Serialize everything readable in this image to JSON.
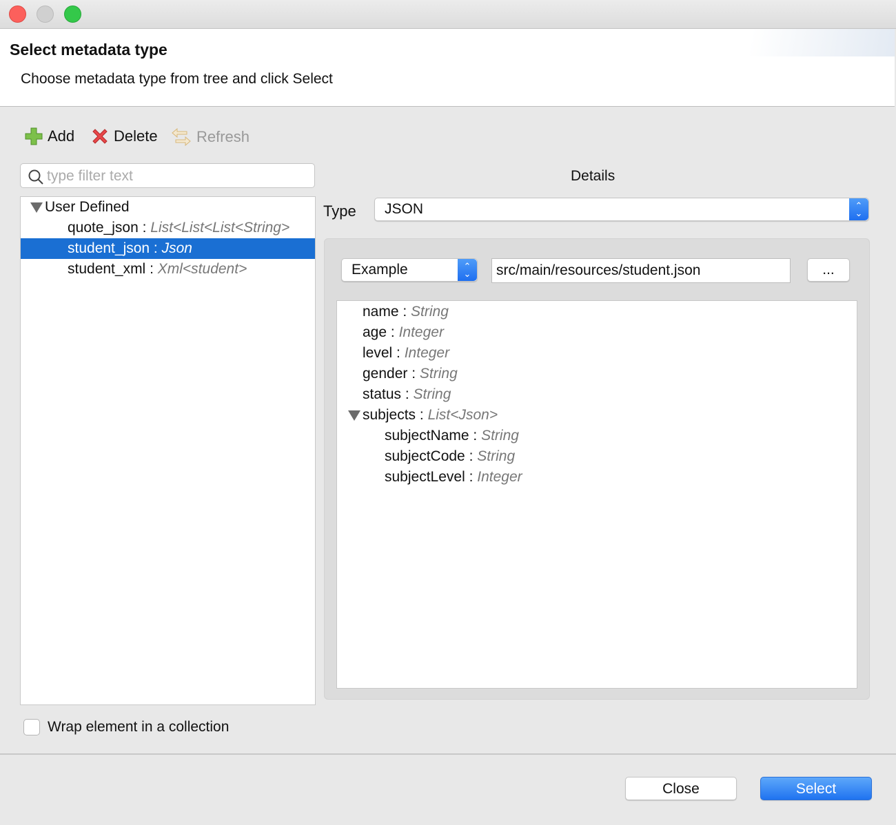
{
  "header": {
    "title": "Select metadata type",
    "subtitle": "Choose metadata type from tree and click Select"
  },
  "toolbar": {
    "add": "Add",
    "delete": "Delete",
    "refresh": "Refresh"
  },
  "filter": {
    "placeholder": "type filter text"
  },
  "tree": {
    "group": "User Defined",
    "items": [
      {
        "name": "quote_json",
        "sep": " : ",
        "type": "List<List<List<String>"
      },
      {
        "name": "student_json",
        "sep": " : ",
        "type": "Json",
        "selected": true
      },
      {
        "name": "student_xml",
        "sep": " : ",
        "type": "Xml<student>"
      }
    ]
  },
  "details": {
    "heading": "Details",
    "type_label": "Type",
    "type_value": "JSON",
    "source_value": "Example",
    "path_value": "src/main/resources/student.json",
    "browse_label": "...",
    "fields": [
      {
        "name": "name",
        "sep": " : ",
        "type": "String"
      },
      {
        "name": "age",
        "sep": " : ",
        "type": "Integer"
      },
      {
        "name": "level",
        "sep": " : ",
        "type": "Integer"
      },
      {
        "name": "gender",
        "sep": " : ",
        "type": "String"
      },
      {
        "name": "status",
        "sep": " : ",
        "type": "String"
      },
      {
        "name": "subjects",
        "sep": " : ",
        "type": "List<Json>"
      },
      {
        "name": "subjectName",
        "sep": " : ",
        "type": "String"
      },
      {
        "name": "subjectCode",
        "sep": " : ",
        "type": "String"
      },
      {
        "name": "subjectLevel",
        "sep": " : ",
        "type": "Integer"
      }
    ]
  },
  "wrap": {
    "label": "Wrap element in a collection",
    "checked": false
  },
  "footer": {
    "close": "Close",
    "select": "Select"
  },
  "colors": {
    "selection": "#1a6fd3",
    "primary": "#2f80f5"
  }
}
